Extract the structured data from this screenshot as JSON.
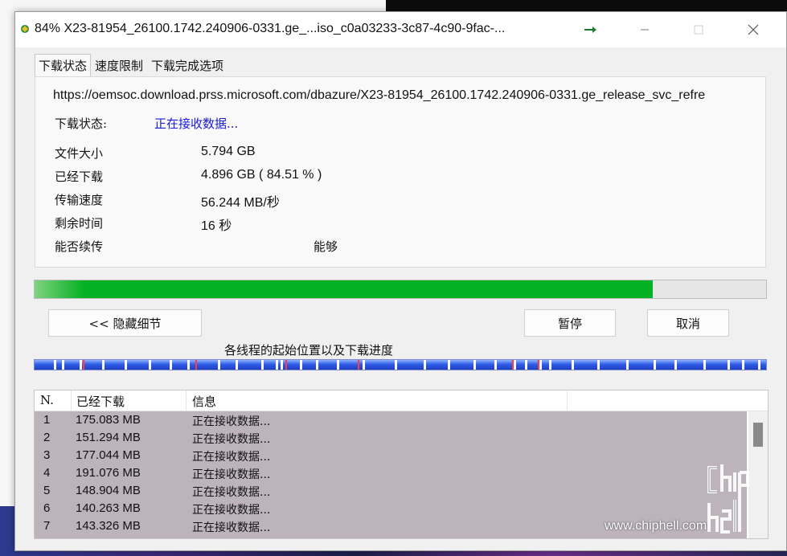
{
  "window": {
    "title": "84% X23-81954_26100.1742.240906-0331.ge_...iso_c0a03233-3c87-4c90-9fac-...",
    "title_icon": "download-globe-icon"
  },
  "tabs": [
    {
      "label": "下载状态",
      "active": true
    },
    {
      "label": "速度限制",
      "active": false
    },
    {
      "label": "下载完成选项",
      "active": false
    }
  ],
  "status": {
    "url": "https://oemsoc.download.prss.microsoft.com/dbazure/X23-81954_26100.1742.240906-0331.ge_release_svc_refre",
    "label": "下载状态:",
    "value": "正在接收数据..."
  },
  "info": {
    "file_size": {
      "label": "文件大小",
      "value": "5.794  GB"
    },
    "downloaded": {
      "label": "已经下载",
      "value": "4.896  GB  ( 84.51 % )"
    },
    "speed": {
      "label": "传输速度",
      "value": "56.244  MB/秒"
    },
    "remaining": {
      "label": "剩余时间",
      "value": "16  秒"
    },
    "resume": {
      "label": "能否续传",
      "value": "能够"
    }
  },
  "progress": {
    "fraction": 0.8451,
    "color": "#06b025"
  },
  "buttons": {
    "hide_details": "<< 隐藏细节",
    "pause": "暂停",
    "cancel": "取消"
  },
  "threads": {
    "label": "各线程的起始位置以及下载进度"
  },
  "list": {
    "columns": [
      "N.",
      "已经下载",
      "信息"
    ],
    "rows": [
      {
        "n": "1",
        "downloaded": "175.083  MB",
        "info": "正在接收数据..."
      },
      {
        "n": "2",
        "downloaded": "151.294  MB",
        "info": "正在接收数据..."
      },
      {
        "n": "3",
        "downloaded": "177.044  MB",
        "info": "正在接收数据..."
      },
      {
        "n": "4",
        "downloaded": "191.076  MB",
        "info": "正在接收数据..."
      },
      {
        "n": "5",
        "downloaded": "148.904  MB",
        "info": "正在接收数据..."
      },
      {
        "n": "6",
        "downloaded": "140.263  MB",
        "info": "正在接收数据..."
      },
      {
        "n": "7",
        "downloaded": "143.326  MB",
        "info": "正在接收数据..."
      }
    ]
  },
  "watermark": {
    "site": "www.chiphell.com",
    "logo_text": "chip hell"
  }
}
